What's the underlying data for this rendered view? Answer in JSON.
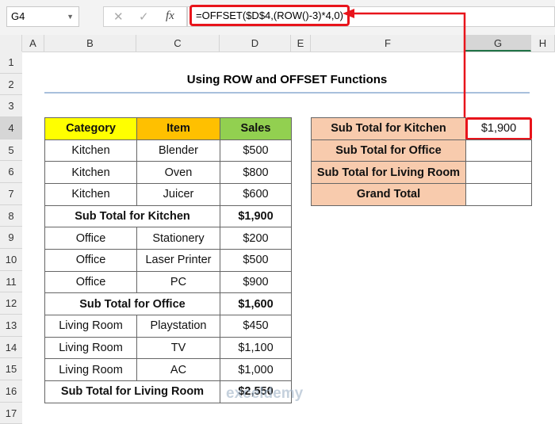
{
  "formula_bar": {
    "name_box": "G4",
    "cancel_icon": "✕",
    "enter_icon": "✓",
    "fx_label": "fx",
    "formula": "=OFFSET($D$4,(ROW()-3)*4,0)"
  },
  "columns": [
    "A",
    "B",
    "C",
    "D",
    "E",
    "F",
    "G",
    "H"
  ],
  "rows": [
    "1",
    "2",
    "3",
    "4",
    "5",
    "6",
    "7",
    "8",
    "9",
    "10",
    "11",
    "12",
    "13",
    "14",
    "15",
    "16",
    "17"
  ],
  "title": "Using ROW and OFFSET Functions",
  "table": {
    "headers": [
      "Category",
      "Item",
      "Sales"
    ],
    "rows": [
      [
        "Kitchen",
        "Blender",
        "$500"
      ],
      [
        "Kitchen",
        "Oven",
        "$800"
      ],
      [
        "Kitchen",
        "Juicer",
        "$600"
      ],
      [
        "Sub Total for Kitchen",
        "",
        "$1,900"
      ],
      [
        "Office",
        "Stationery",
        "$200"
      ],
      [
        "Office",
        "Laser Printer",
        "$500"
      ],
      [
        "Office",
        "PC",
        "$900"
      ],
      [
        "Sub Total for Office",
        "",
        "$1,600"
      ],
      [
        "Living Room",
        "Playstation",
        "$450"
      ],
      [
        "Living Room",
        "TV",
        "$1,100"
      ],
      [
        "Living Room",
        "AC",
        "$1,000"
      ],
      [
        "Sub Total for Living Room",
        "",
        "$2,550"
      ]
    ]
  },
  "summary": [
    {
      "label": "Sub Total for Kitchen",
      "value": "$1,900"
    },
    {
      "label": "Sub Total for Office",
      "value": ""
    },
    {
      "label": "Sub Total for Living Room",
      "value": ""
    },
    {
      "label": "Grand Total",
      "value": ""
    }
  ],
  "watermark": "exceldemy",
  "colors": {
    "category_header": "#ffff00",
    "item_header": "#ffc000",
    "sales_header": "#92d050",
    "summary_label": "#f8cbad",
    "highlight": "#e8141b"
  }
}
